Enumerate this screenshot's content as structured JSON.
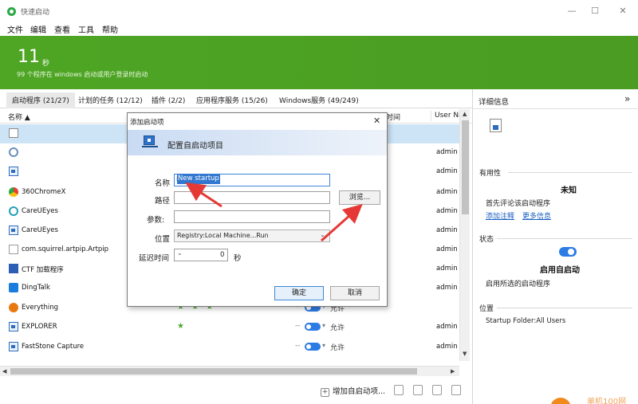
{
  "window": {
    "title": "快速启动",
    "minimize": "—",
    "maximize": "☐",
    "close": "✕"
  },
  "menu": [
    "文件",
    "编辑",
    "查看",
    "工具",
    "帮助"
  ],
  "banner": {
    "count": "11",
    "unit": "秒",
    "subtitle": "99 个程序在 windows 启动或用户登录时启动"
  },
  "tabs": [
    {
      "label": "启动程序 (21/27)",
      "active": true
    },
    {
      "label": "计划的任务 (12/12)",
      "active": false
    },
    {
      "label": "插件 (2/2)",
      "active": false
    },
    {
      "label": "应用程序服务 (15/26)",
      "active": false
    },
    {
      "label": "Windows服务 (49/249)",
      "active": false
    }
  ],
  "table": {
    "col_name": "名称 ▲",
    "col_time": "时间",
    "col_user": "User Na",
    "rows": [
      {
        "name": "",
        "user": "",
        "icon": "blank-file-icon",
        "selected": true,
        "stars": "",
        "dash": "",
        "toggle": false,
        "status": ""
      },
      {
        "name": "",
        "user": "admin",
        "icon": "gear-icon",
        "selected": false,
        "stars": "",
        "dash": "",
        "toggle": false,
        "status": ""
      },
      {
        "name": "",
        "user": "admin",
        "icon": "window-icon",
        "selected": false,
        "stars": "",
        "dash": "",
        "toggle": false,
        "status": ""
      },
      {
        "name": "360ChromeX",
        "user": "admin",
        "icon": "chrome-icon",
        "selected": false,
        "stars": "",
        "dash": "",
        "toggle": false,
        "status": ""
      },
      {
        "name": "CareUEyes",
        "user": "admin",
        "icon": "eye-icon",
        "selected": false,
        "stars": "",
        "dash": "",
        "toggle": false,
        "status": ""
      },
      {
        "name": "CareUEyes",
        "user": "admin",
        "icon": "window-icon",
        "selected": false,
        "stars": "",
        "dash": "",
        "toggle": false,
        "status": ""
      },
      {
        "name": "com.squirrel.artpip.Artpip",
        "user": "admin",
        "icon": "document-icon",
        "selected": false,
        "stars": "",
        "dash": "",
        "toggle": false,
        "status": ""
      },
      {
        "name": "CTF 加载程序",
        "user": "admin",
        "icon": "pen-icon",
        "selected": false,
        "stars": "",
        "dash": "",
        "toggle": false,
        "status": ""
      },
      {
        "name": "DingTalk",
        "user": "admin",
        "icon": "dingtalk-icon",
        "selected": false,
        "stars": "",
        "dash": "",
        "toggle": false,
        "status": ""
      },
      {
        "name": "Everything",
        "user": "",
        "icon": "search-icon",
        "selected": false,
        "stars": "★ ★ ★",
        "dash": "--",
        "toggle": true,
        "status": "允许"
      },
      {
        "name": "EXPLORER",
        "user": "admin",
        "icon": "window-icon",
        "selected": false,
        "stars": "★",
        "dash": "--",
        "toggle": true,
        "status": "允许"
      },
      {
        "name": "FastStone Capture",
        "user": "admin",
        "icon": "window-icon",
        "selected": false,
        "stars": "",
        "dash": "--",
        "toggle": true,
        "status": "允许"
      }
    ]
  },
  "bottom": {
    "add_label": "增加自启动项...",
    "plus": "+"
  },
  "details": {
    "title": "详细信息",
    "expand": "»",
    "usefulness_label": "有用性",
    "rating": "未知",
    "rating_desc": "首先评论该启动程序",
    "add_comment": "添加注释",
    "more_info": "更多信息",
    "status_label": "状态",
    "status_value": "启用自启动",
    "status_desc": "启用所选的启动程序",
    "location_label": "位置",
    "location_value": "Startup Folder:All Users"
  },
  "dialog": {
    "title": "添加启动项",
    "close": "✕",
    "heading": "配置自启动项目",
    "name_label": "名称",
    "name_value": "New startup",
    "path_label": "路径",
    "path_value": "",
    "browse": "浏览...",
    "args_label": "参数:",
    "args_value": "",
    "location_label": "位置",
    "location_value": "Registry:Local Machine...Run",
    "delay_label": "延迟时间",
    "delay_value": "0",
    "delay_unit": "秒",
    "ok": "确定",
    "cancel": "取消"
  },
  "watermark": {
    "text": "单机100网"
  },
  "colors": {
    "banner": "#4ea624",
    "accent": "#2d7be5",
    "annotation": "#e53935"
  }
}
